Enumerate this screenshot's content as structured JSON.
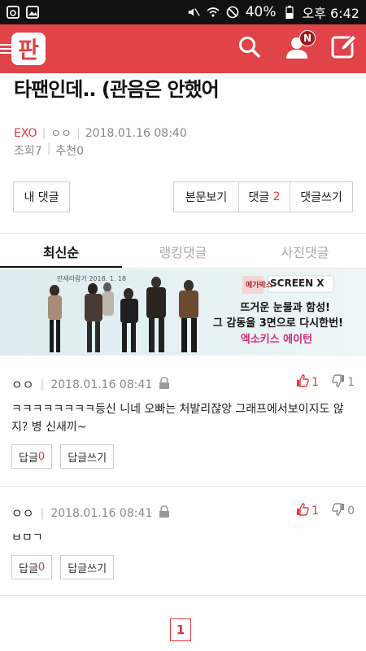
{
  "status_bar": {
    "battery_percent": "40%",
    "time": "오후 6:42",
    "icons": [
      "gallery-icon",
      "image-icon",
      "mute-icon",
      "wifi-icon",
      "no-disturb-icon",
      "battery-icon"
    ]
  },
  "app_bar": {
    "logo_text": "판",
    "notification_badge": "N",
    "icons": [
      "menu-icon",
      "search-icon",
      "profile-icon",
      "write-icon"
    ],
    "accent_color": "#e04348"
  },
  "post": {
    "title": "타팬인데.. (관음은 안했어",
    "category": "EXO",
    "author": "ㅇㅇ",
    "datetime": "2018.01.16 08:40",
    "views_label": "조회",
    "views": "7",
    "recommend_label": "추천",
    "recommend": "0"
  },
  "actions": {
    "my_comments": "내 댓글",
    "view_post": "본문보기",
    "comments_label": "댓글",
    "comments_count": "2",
    "write_comment": "댓글쓰기"
  },
  "tabs": [
    {
      "label": "최신순",
      "active": true
    },
    {
      "label": "랭킹댓글",
      "active": false
    },
    {
      "label": "사진댓글",
      "active": false
    }
  ],
  "banner": {
    "date": "만세라람가 2018. 1. 18",
    "brand": "메가박스",
    "format": "SCREEN X",
    "line1": "뜨거운 눈물과 함성!",
    "line2": "그 감동을 3면으로 다시한번!",
    "line3": "엑소키스 에이턴"
  },
  "comments": [
    {
      "author": "ㅇㅇ",
      "datetime": "2018.01.16 08:41",
      "likes": "1",
      "dislikes": "1",
      "text": "ㅋㅋㅋㅋㅋㅋㅋㅋ등신 니네 오빠는 처발리잖앙 그래프에서보이지도 않지? 병 신새끼~",
      "reply_label": "답글",
      "reply_count": "0",
      "write_reply": "답글쓰기"
    },
    {
      "author": "ㅇㅇ",
      "datetime": "2018.01.16 08:41",
      "likes": "1",
      "dislikes": "0",
      "text": "ㅂㅁㄱ",
      "reply_label": "답글",
      "reply_count": "0",
      "write_reply": "답글쓰기"
    }
  ],
  "pagination": {
    "current": "1"
  }
}
